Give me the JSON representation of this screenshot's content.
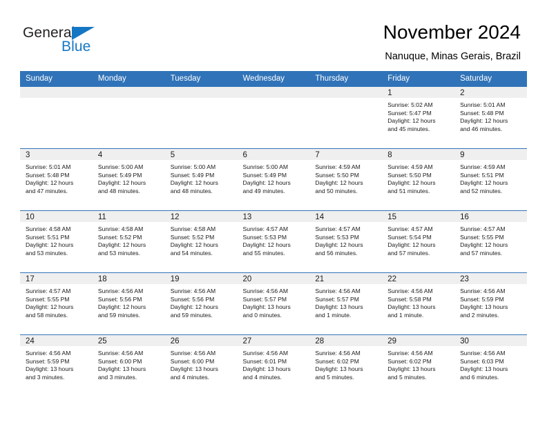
{
  "brand": {
    "word_one": "General",
    "word_two": "Blue",
    "triangle_icon": "brand-triangle-icon",
    "accent_color": "#1577c4"
  },
  "header": {
    "title": "November 2024",
    "subtitle": "Nanuque, Minas Gerais, Brazil"
  },
  "theme": {
    "header_blue": "#3073b8",
    "daynum_band": "#efefef",
    "text": "#1a1a1a"
  },
  "weekday_headers": [
    "Sunday",
    "Monday",
    "Tuesday",
    "Wednesday",
    "Thursday",
    "Friday",
    "Saturday"
  ],
  "labels": {
    "sunrise_prefix": "Sunrise:",
    "sunset_prefix": "Sunset:",
    "daylight_prefix": "Daylight:"
  },
  "weeks": [
    [
      {
        "day": "",
        "empty": true
      },
      {
        "day": "",
        "empty": true
      },
      {
        "day": "",
        "empty": true
      },
      {
        "day": "",
        "empty": true
      },
      {
        "day": "",
        "empty": true
      },
      {
        "day": "1",
        "sunrise": "Sunrise: 5:02 AM",
        "sunset": "Sunset: 5:47 PM",
        "daylight_line1": "Daylight: 12 hours",
        "daylight_line2": "and 45 minutes."
      },
      {
        "day": "2",
        "sunrise": "Sunrise: 5:01 AM",
        "sunset": "Sunset: 5:48 PM",
        "daylight_line1": "Daylight: 12 hours",
        "daylight_line2": "and 46 minutes."
      }
    ],
    [
      {
        "day": "3",
        "sunrise": "Sunrise: 5:01 AM",
        "sunset": "Sunset: 5:48 PM",
        "daylight_line1": "Daylight: 12 hours",
        "daylight_line2": "and 47 minutes."
      },
      {
        "day": "4",
        "sunrise": "Sunrise: 5:00 AM",
        "sunset": "Sunset: 5:49 PM",
        "daylight_line1": "Daylight: 12 hours",
        "daylight_line2": "and 48 minutes."
      },
      {
        "day": "5",
        "sunrise": "Sunrise: 5:00 AM",
        "sunset": "Sunset: 5:49 PM",
        "daylight_line1": "Daylight: 12 hours",
        "daylight_line2": "and 48 minutes."
      },
      {
        "day": "6",
        "sunrise": "Sunrise: 5:00 AM",
        "sunset": "Sunset: 5:49 PM",
        "daylight_line1": "Daylight: 12 hours",
        "daylight_line2": "and 49 minutes."
      },
      {
        "day": "7",
        "sunrise": "Sunrise: 4:59 AM",
        "sunset": "Sunset: 5:50 PM",
        "daylight_line1": "Daylight: 12 hours",
        "daylight_line2": "and 50 minutes."
      },
      {
        "day": "8",
        "sunrise": "Sunrise: 4:59 AM",
        "sunset": "Sunset: 5:50 PM",
        "daylight_line1": "Daylight: 12 hours",
        "daylight_line2": "and 51 minutes."
      },
      {
        "day": "9",
        "sunrise": "Sunrise: 4:59 AM",
        "sunset": "Sunset: 5:51 PM",
        "daylight_line1": "Daylight: 12 hours",
        "daylight_line2": "and 52 minutes."
      }
    ],
    [
      {
        "day": "10",
        "sunrise": "Sunrise: 4:58 AM",
        "sunset": "Sunset: 5:51 PM",
        "daylight_line1": "Daylight: 12 hours",
        "daylight_line2": "and 53 minutes."
      },
      {
        "day": "11",
        "sunrise": "Sunrise: 4:58 AM",
        "sunset": "Sunset: 5:52 PM",
        "daylight_line1": "Daylight: 12 hours",
        "daylight_line2": "and 53 minutes."
      },
      {
        "day": "12",
        "sunrise": "Sunrise: 4:58 AM",
        "sunset": "Sunset: 5:52 PM",
        "daylight_line1": "Daylight: 12 hours",
        "daylight_line2": "and 54 minutes."
      },
      {
        "day": "13",
        "sunrise": "Sunrise: 4:57 AM",
        "sunset": "Sunset: 5:53 PM",
        "daylight_line1": "Daylight: 12 hours",
        "daylight_line2": "and 55 minutes."
      },
      {
        "day": "14",
        "sunrise": "Sunrise: 4:57 AM",
        "sunset": "Sunset: 5:53 PM",
        "daylight_line1": "Daylight: 12 hours",
        "daylight_line2": "and 56 minutes."
      },
      {
        "day": "15",
        "sunrise": "Sunrise: 4:57 AM",
        "sunset": "Sunset: 5:54 PM",
        "daylight_line1": "Daylight: 12 hours",
        "daylight_line2": "and 57 minutes."
      },
      {
        "day": "16",
        "sunrise": "Sunrise: 4:57 AM",
        "sunset": "Sunset: 5:55 PM",
        "daylight_line1": "Daylight: 12 hours",
        "daylight_line2": "and 57 minutes."
      }
    ],
    [
      {
        "day": "17",
        "sunrise": "Sunrise: 4:57 AM",
        "sunset": "Sunset: 5:55 PM",
        "daylight_line1": "Daylight: 12 hours",
        "daylight_line2": "and 58 minutes."
      },
      {
        "day": "18",
        "sunrise": "Sunrise: 4:56 AM",
        "sunset": "Sunset: 5:56 PM",
        "daylight_line1": "Daylight: 12 hours",
        "daylight_line2": "and 59 minutes."
      },
      {
        "day": "19",
        "sunrise": "Sunrise: 4:56 AM",
        "sunset": "Sunset: 5:56 PM",
        "daylight_line1": "Daylight: 12 hours",
        "daylight_line2": "and 59 minutes."
      },
      {
        "day": "20",
        "sunrise": "Sunrise: 4:56 AM",
        "sunset": "Sunset: 5:57 PM",
        "daylight_line1": "Daylight: 13 hours",
        "daylight_line2": "and 0 minutes."
      },
      {
        "day": "21",
        "sunrise": "Sunrise: 4:56 AM",
        "sunset": "Sunset: 5:57 PM",
        "daylight_line1": "Daylight: 13 hours",
        "daylight_line2": "and 1 minute."
      },
      {
        "day": "22",
        "sunrise": "Sunrise: 4:56 AM",
        "sunset": "Sunset: 5:58 PM",
        "daylight_line1": "Daylight: 13 hours",
        "daylight_line2": "and 1 minute."
      },
      {
        "day": "23",
        "sunrise": "Sunrise: 4:56 AM",
        "sunset": "Sunset: 5:59 PM",
        "daylight_line1": "Daylight: 13 hours",
        "daylight_line2": "and 2 minutes."
      }
    ],
    [
      {
        "day": "24",
        "sunrise": "Sunrise: 4:56 AM",
        "sunset": "Sunset: 5:59 PM",
        "daylight_line1": "Daylight: 13 hours",
        "daylight_line2": "and 3 minutes."
      },
      {
        "day": "25",
        "sunrise": "Sunrise: 4:56 AM",
        "sunset": "Sunset: 6:00 PM",
        "daylight_line1": "Daylight: 13 hours",
        "daylight_line2": "and 3 minutes."
      },
      {
        "day": "26",
        "sunrise": "Sunrise: 4:56 AM",
        "sunset": "Sunset: 6:00 PM",
        "daylight_line1": "Daylight: 13 hours",
        "daylight_line2": "and 4 minutes."
      },
      {
        "day": "27",
        "sunrise": "Sunrise: 4:56 AM",
        "sunset": "Sunset: 6:01 PM",
        "daylight_line1": "Daylight: 13 hours",
        "daylight_line2": "and 4 minutes."
      },
      {
        "day": "28",
        "sunrise": "Sunrise: 4:56 AM",
        "sunset": "Sunset: 6:02 PM",
        "daylight_line1": "Daylight: 13 hours",
        "daylight_line2": "and 5 minutes."
      },
      {
        "day": "29",
        "sunrise": "Sunrise: 4:56 AM",
        "sunset": "Sunset: 6:02 PM",
        "daylight_line1": "Daylight: 13 hours",
        "daylight_line2": "and 5 minutes."
      },
      {
        "day": "30",
        "sunrise": "Sunrise: 4:56 AM",
        "sunset": "Sunset: 6:03 PM",
        "daylight_line1": "Daylight: 13 hours",
        "daylight_line2": "and 6 minutes."
      }
    ]
  ]
}
